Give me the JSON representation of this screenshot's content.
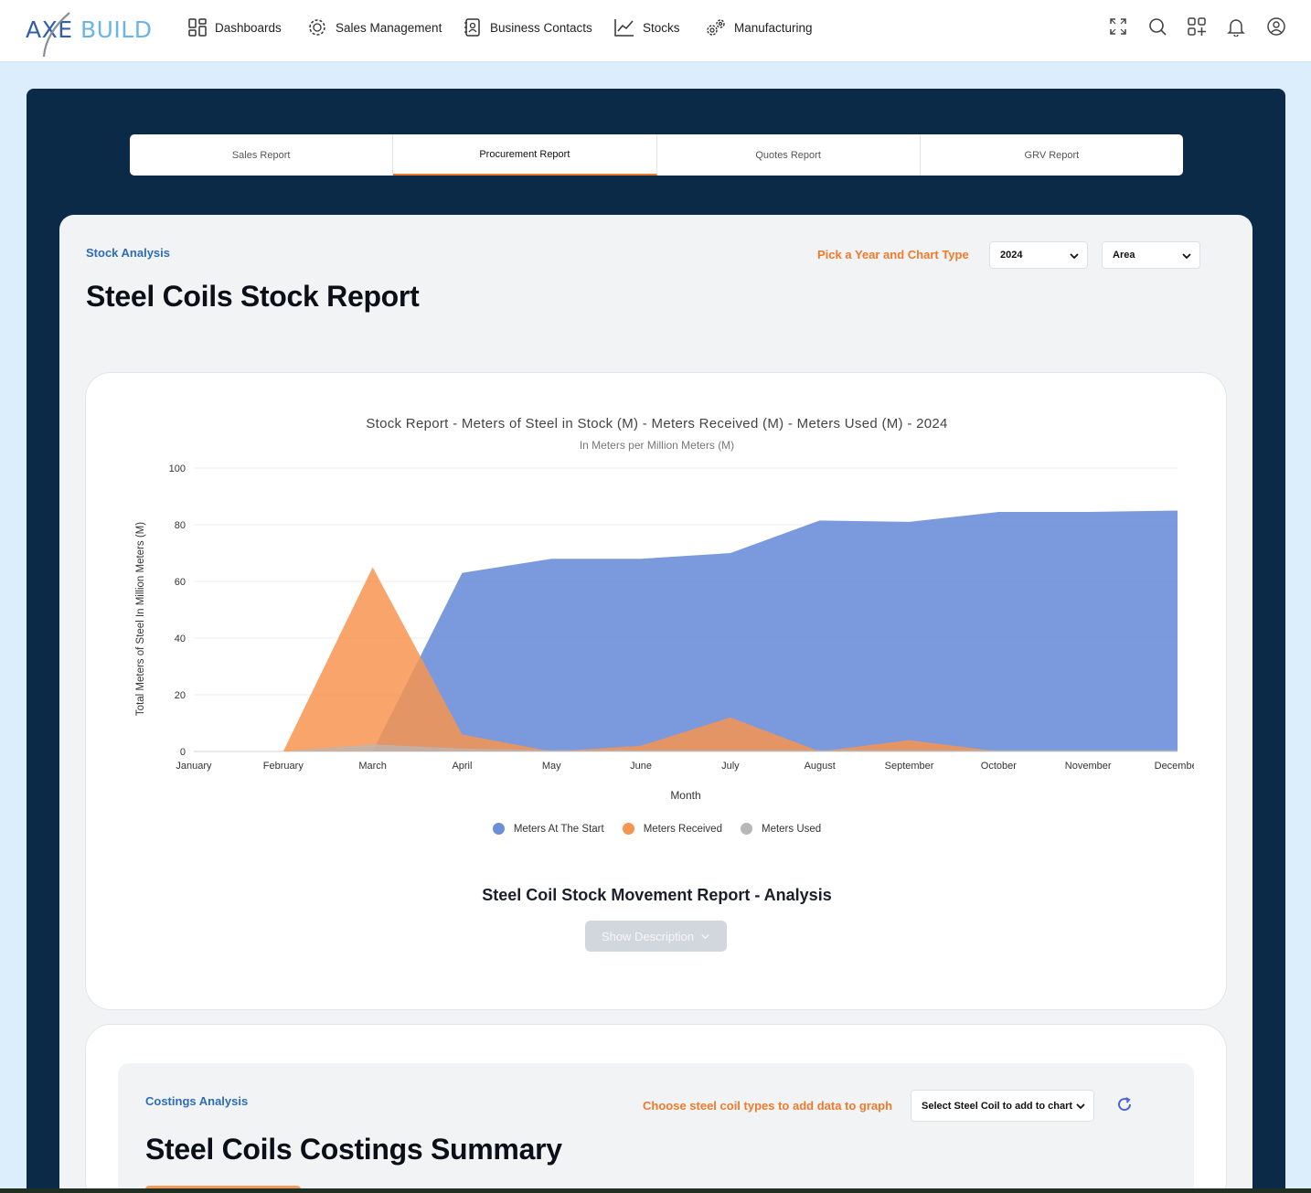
{
  "app": {
    "logo_primary": "AXE",
    "logo_secondary": "BUILD"
  },
  "nav": {
    "items": [
      {
        "label": "Dashboards",
        "icon": "dashboard-grid-icon"
      },
      {
        "label": "Sales Management",
        "icon": "sales-gear-icon"
      },
      {
        "label": "Business Contacts",
        "icon": "contacts-book-icon"
      },
      {
        "label": "Stocks",
        "icon": "trend-chart-icon"
      },
      {
        "label": "Manufacturing",
        "icon": "gears-icon"
      }
    ],
    "right_icons": [
      "fullscreen-icon",
      "search-icon",
      "apps-add-icon",
      "bell-icon",
      "user-icon"
    ]
  },
  "tabs": [
    {
      "label": "Sales Report",
      "active": false
    },
    {
      "label": "Procurement Report",
      "active": true
    },
    {
      "label": "Quotes Report",
      "active": false
    },
    {
      "label": "GRV Report",
      "active": false
    }
  ],
  "stock_section": {
    "eyebrow": "Stock Analysis",
    "title": "Steel Coils Stock Report",
    "pick_label": "Pick a Year and Chart Type",
    "year_value": "2024",
    "chart_type_value": "Area",
    "analysis_title": "Steel Coil Stock Movement Report - Analysis",
    "show_description_label": "Show Description"
  },
  "chart_data": {
    "type": "area",
    "title": "Stock Report - Meters of Steel in Stock (M) - Meters Received (M) - Meters Used (M) - 2024",
    "subtitle": "In Meters per Million Meters (M)",
    "xlabel": "Month",
    "ylabel": "Total Meters of Steel In Million Meters (M)",
    "ylim": [
      0,
      100
    ],
    "yticks": [
      0,
      20,
      40,
      60,
      80,
      100
    ],
    "categories": [
      "January",
      "February",
      "March",
      "April",
      "May",
      "June",
      "July",
      "August",
      "September",
      "October",
      "November",
      "December"
    ],
    "grid": true,
    "legend_position": "bottom",
    "series": [
      {
        "name": "Meters At The Start",
        "color": "#6b8fd9",
        "values": [
          0,
          0,
          0,
          63,
          68,
          68,
          70,
          81.5,
          81,
          84.5,
          84.5,
          85
        ]
      },
      {
        "name": "Meters Received",
        "color": "#f79450",
        "values": [
          0,
          0,
          65,
          6,
          0,
          2,
          12,
          0,
          4,
          0,
          0,
          0
        ]
      },
      {
        "name": "Meters Used",
        "color": "#b8b8b8",
        "values": [
          0,
          0,
          2.5,
          1,
          0.5,
          0.5,
          0.5,
          0.5,
          0.5,
          0.5,
          0.5,
          0.5
        ]
      }
    ]
  },
  "costings_section": {
    "eyebrow": "Costings Analysis",
    "title": "Steel Coils Costings Summary",
    "choose_label": "Choose steel coil types to add data to graph",
    "select_value": "Select Steel Coil to add to chart"
  }
}
